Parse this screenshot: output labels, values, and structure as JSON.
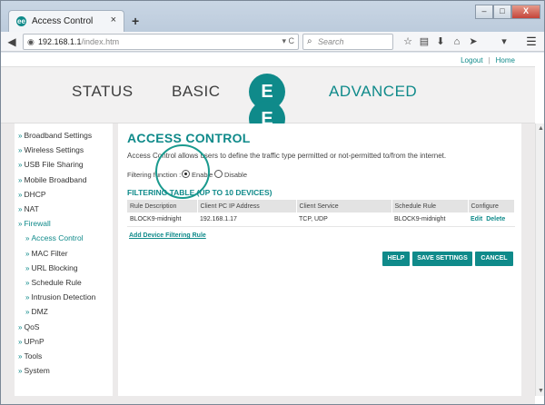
{
  "browser": {
    "tab_title": "Access Control",
    "tab_close": "×",
    "new_tab": "+",
    "url_host": "192.168.1.1",
    "url_path": "/index.htm",
    "url_controls": "▾ C",
    "search_placeholder": "Search",
    "window_controls": [
      "–",
      "□",
      "X"
    ]
  },
  "page": {
    "top_links": [
      "Logout",
      "Home"
    ],
    "top_links_sep": "|",
    "nav": {
      "status": "STATUS",
      "basic": "BASIC",
      "advanced": "ADVANCED",
      "logo_letter": "E"
    },
    "sidebar": [
      {
        "label": "Broadband Settings",
        "sub": false
      },
      {
        "label": "Wireless Settings",
        "sub": false
      },
      {
        "label": "USB File Sharing",
        "sub": false
      },
      {
        "label": "Mobile Broadband",
        "sub": false
      },
      {
        "label": "DHCP",
        "sub": false
      },
      {
        "label": "NAT",
        "sub": false
      },
      {
        "label": "Firewall",
        "sub": false,
        "active": true
      },
      {
        "label": "Access Control",
        "sub": true,
        "active": true
      },
      {
        "label": "MAC Filter",
        "sub": true
      },
      {
        "label": "URL Blocking",
        "sub": true
      },
      {
        "label": "Schedule Rule",
        "sub": true
      },
      {
        "label": "Intrusion Detection",
        "sub": true
      },
      {
        "label": "DMZ",
        "sub": true
      },
      {
        "label": "QoS",
        "sub": false
      },
      {
        "label": "UPnP",
        "sub": false
      },
      {
        "label": "Tools",
        "sub": false
      },
      {
        "label": "System",
        "sub": false
      }
    ],
    "main": {
      "title": "ACCESS CONTROL",
      "description": "Access Control allows users to define the traffic type permitted or not-permitted to/from the internet.",
      "filtering_label": "Filtering function :",
      "enable_label": "Enable",
      "disable_label": "Disable",
      "filtering_enabled": true,
      "table_title": "FILTERING TABLE (UP TO 10 DEVICES)",
      "columns": [
        "Rule Description",
        "Client PC IP Address",
        "Client Service",
        "Schedule Rule",
        "Configure"
      ],
      "rows": [
        {
          "rule": "BLOCK9-midnight",
          "ip": "192.168.1.17",
          "service": "TCP, UDP",
          "schedule": "BLOCK9-midnight",
          "edit": "Edit",
          "delete": "Delete"
        }
      ],
      "add_rule": "Add Device Filtering Rule",
      "buttons": {
        "help": "HELP",
        "save": "SAVE SETTINGS",
        "cancel": "CANCEL"
      }
    }
  },
  "colors": {
    "accent": "#0f8a8a"
  }
}
